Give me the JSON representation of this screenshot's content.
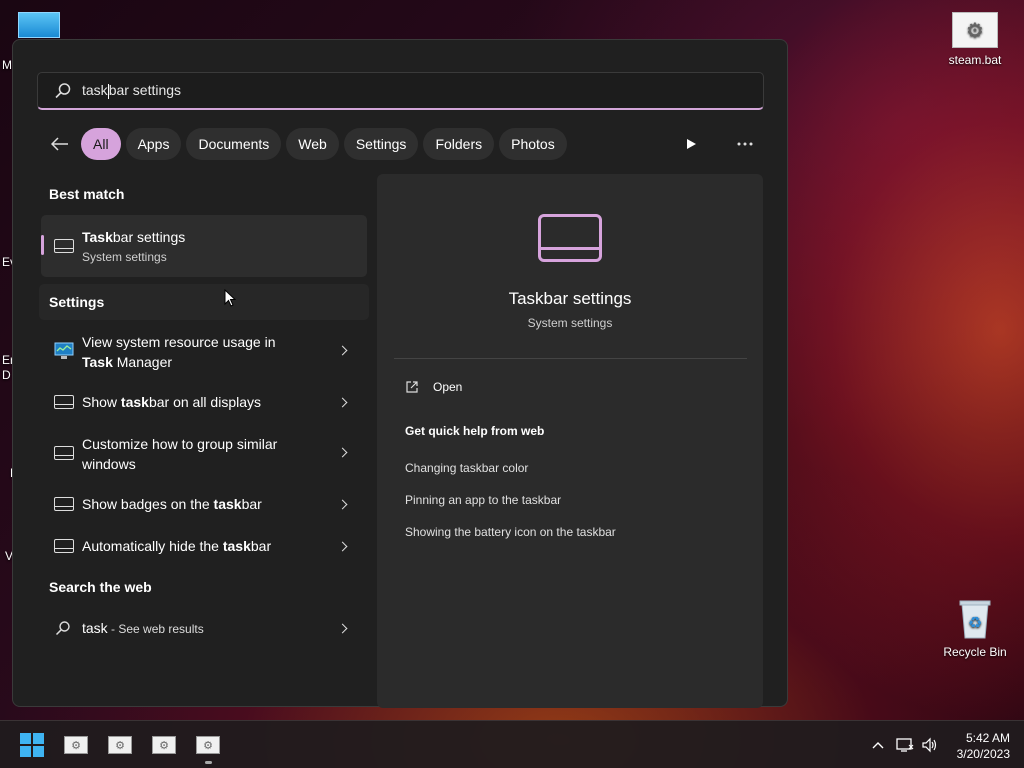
{
  "desktop": {
    "icons": [
      {
        "label": "steam.bat"
      },
      {
        "label": "Recycle Bin"
      }
    ],
    "left_edge_letters": [
      "M",
      "Ev",
      "Er",
      "D",
      "F",
      "V"
    ]
  },
  "search": {
    "query": "taskbar settings",
    "query_typed": "task",
    "query_rest": "bar settings"
  },
  "filters": {
    "chips": [
      "All",
      "Apps",
      "Documents",
      "Web",
      "Settings",
      "Folders",
      "Photos"
    ],
    "active": "All"
  },
  "best_match": {
    "heading": "Best match",
    "title_bold": "Task",
    "title_rest": "bar settings",
    "subtitle": "System settings"
  },
  "settings_section": {
    "heading": "Settings",
    "items": [
      {
        "line1": "View system resource usage in",
        "line2_bold": "Task",
        "line2_rest": " Manager"
      },
      {
        "pre": "Show ",
        "bold": "task",
        "post": "bar on all displays"
      },
      {
        "line1": "Customize how to group similar",
        "line2": "windows"
      },
      {
        "pre": "Show badges on the ",
        "bold": "task",
        "post": "bar"
      },
      {
        "pre": "Automatically hide the ",
        "bold": "task",
        "post": "bar"
      }
    ]
  },
  "web_section": {
    "heading": "Search the web",
    "query": "task",
    "suffix": " - See web results"
  },
  "preview": {
    "title": "Taskbar settings",
    "subtitle": "System settings",
    "open_label": "Open",
    "help_heading": "Get quick help from web",
    "links": [
      "Changing taskbar color",
      "Pinning an app to the taskbar",
      "Showing the battery icon on the taskbar"
    ]
  },
  "taskbar": {
    "time": "5:42 AM",
    "date": "3/20/2023"
  },
  "colors": {
    "accent": "#d6a3dc",
    "panel": "#202020",
    "preview": "#2b2b2b"
  }
}
